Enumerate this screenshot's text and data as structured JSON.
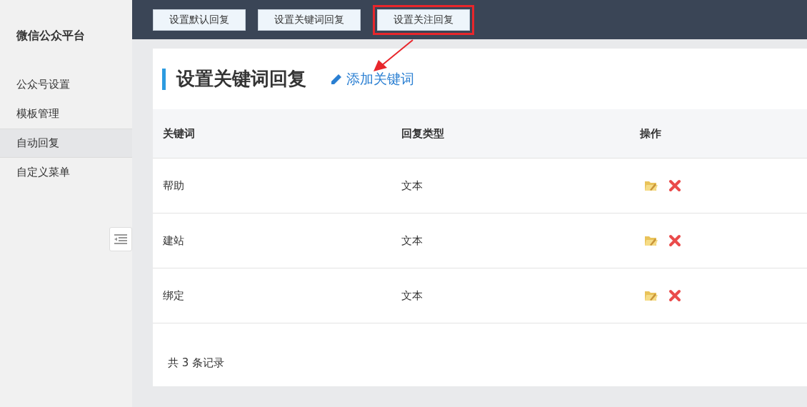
{
  "sidebar": {
    "title": "微信公众平台",
    "items": [
      {
        "label": "公众号设置",
        "selected": false
      },
      {
        "label": "模板管理",
        "selected": false
      },
      {
        "label": "自动回复",
        "selected": true
      },
      {
        "label": "自定义菜单",
        "selected": false
      }
    ]
  },
  "toolbar": {
    "buttons": [
      {
        "label": "设置默认回复",
        "highlighted": false
      },
      {
        "label": "设置关键词回复",
        "highlighted": false
      },
      {
        "label": "设置关注回复",
        "highlighted": true
      }
    ]
  },
  "panel": {
    "title": "设置关键词回复",
    "add_link": "添加关键词",
    "table": {
      "columns": [
        "关键词",
        "回复类型",
        "操作"
      ],
      "rows": [
        {
          "keyword": "帮助",
          "type": "文本"
        },
        {
          "keyword": "建站",
          "type": "文本"
        },
        {
          "keyword": "绑定",
          "type": "文本"
        }
      ]
    },
    "footer": "共 3 条记录"
  }
}
